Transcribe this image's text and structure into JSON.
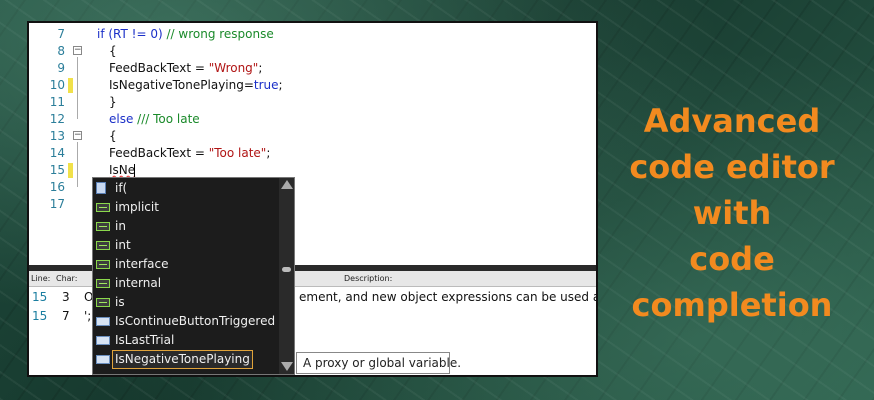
{
  "editor": {
    "lines": [
      {
        "num": "7",
        "segments": [
          {
            "t": "if (RT != 0) ",
            "c": "kw"
          },
          {
            "t": "// wrong response",
            "c": "cm"
          }
        ],
        "indent": "if",
        "fold": false,
        "mod": false
      },
      {
        "num": "8",
        "segments": [
          {
            "t": "{",
            "c": ""
          }
        ],
        "fold": true,
        "mod": false
      },
      {
        "num": "9",
        "segments": [
          {
            "t": "FeedBackText = ",
            "c": ""
          },
          {
            "t": "\"Wrong\"",
            "c": "str"
          },
          {
            "t": ";",
            "c": ""
          }
        ],
        "fold": false,
        "mod": false
      },
      {
        "num": "10",
        "segments": [
          {
            "t": "IsNegativeTonePlaying=",
            "c": ""
          },
          {
            "t": "true",
            "c": "kw"
          },
          {
            "t": ";",
            "c": ""
          }
        ],
        "fold": false,
        "mod": true
      },
      {
        "num": "11",
        "segments": [
          {
            "t": "}",
            "c": ""
          }
        ],
        "fold": false,
        "mod": false
      },
      {
        "num": "12",
        "segments": [
          {
            "t": "else ",
            "c": "kw"
          },
          {
            "t": "/// Too late",
            "c": "cm"
          }
        ],
        "fold": false,
        "mod": false
      },
      {
        "num": "13",
        "segments": [
          {
            "t": "{",
            "c": ""
          }
        ],
        "fold": true,
        "mod": false
      },
      {
        "num": "14",
        "segments": [
          {
            "t": "FeedBackText = ",
            "c": ""
          },
          {
            "t": "\"Too late\"",
            "c": "str"
          },
          {
            "t": ";",
            "c": ""
          }
        ],
        "fold": false,
        "mod": false
      },
      {
        "num": "15",
        "segments": [
          {
            "t": "IsNe",
            "c": "sq"
          }
        ],
        "fold": false,
        "mod": true
      },
      {
        "num": "16",
        "segments": [],
        "fold": false,
        "mod": false
      },
      {
        "num": "17",
        "segments": [],
        "fold": false,
        "mod": false
      }
    ]
  },
  "error_list": {
    "headers": {
      "line": "Line:",
      "char": "Char:",
      "description": "Description:"
    },
    "rows": [
      {
        "line": "15",
        "char": "3",
        "desc": "O",
        "desc_tail": "ement, and new object expressions can be used as a sta"
      },
      {
        "line": "15",
        "char": "7",
        "desc": "';'",
        "desc_tail": ""
      }
    ]
  },
  "completion": {
    "items": [
      {
        "label": "if(",
        "icon": "doc-icon"
      },
      {
        "label": "implicit",
        "icon": "keyword-icon"
      },
      {
        "label": "in",
        "icon": "keyword-icon"
      },
      {
        "label": "int",
        "icon": "keyword-icon"
      },
      {
        "label": "interface",
        "icon": "keyword-icon"
      },
      {
        "label": "internal",
        "icon": "keyword-icon"
      },
      {
        "label": "is",
        "icon": "keyword-icon"
      },
      {
        "label": "IsContinueButtonTriggered",
        "icon": "variable-icon"
      },
      {
        "label": "IsLastTrial",
        "icon": "variable-icon"
      },
      {
        "label": "IsNegativeTonePlaying",
        "icon": "variable-icon"
      }
    ],
    "selected_index": 9,
    "tooltip": "A proxy or global variable."
  },
  "promo": {
    "lines": [
      "Advanced",
      "code editor",
      "with",
      "code",
      "completion"
    ],
    "color": "#f28a1f"
  }
}
